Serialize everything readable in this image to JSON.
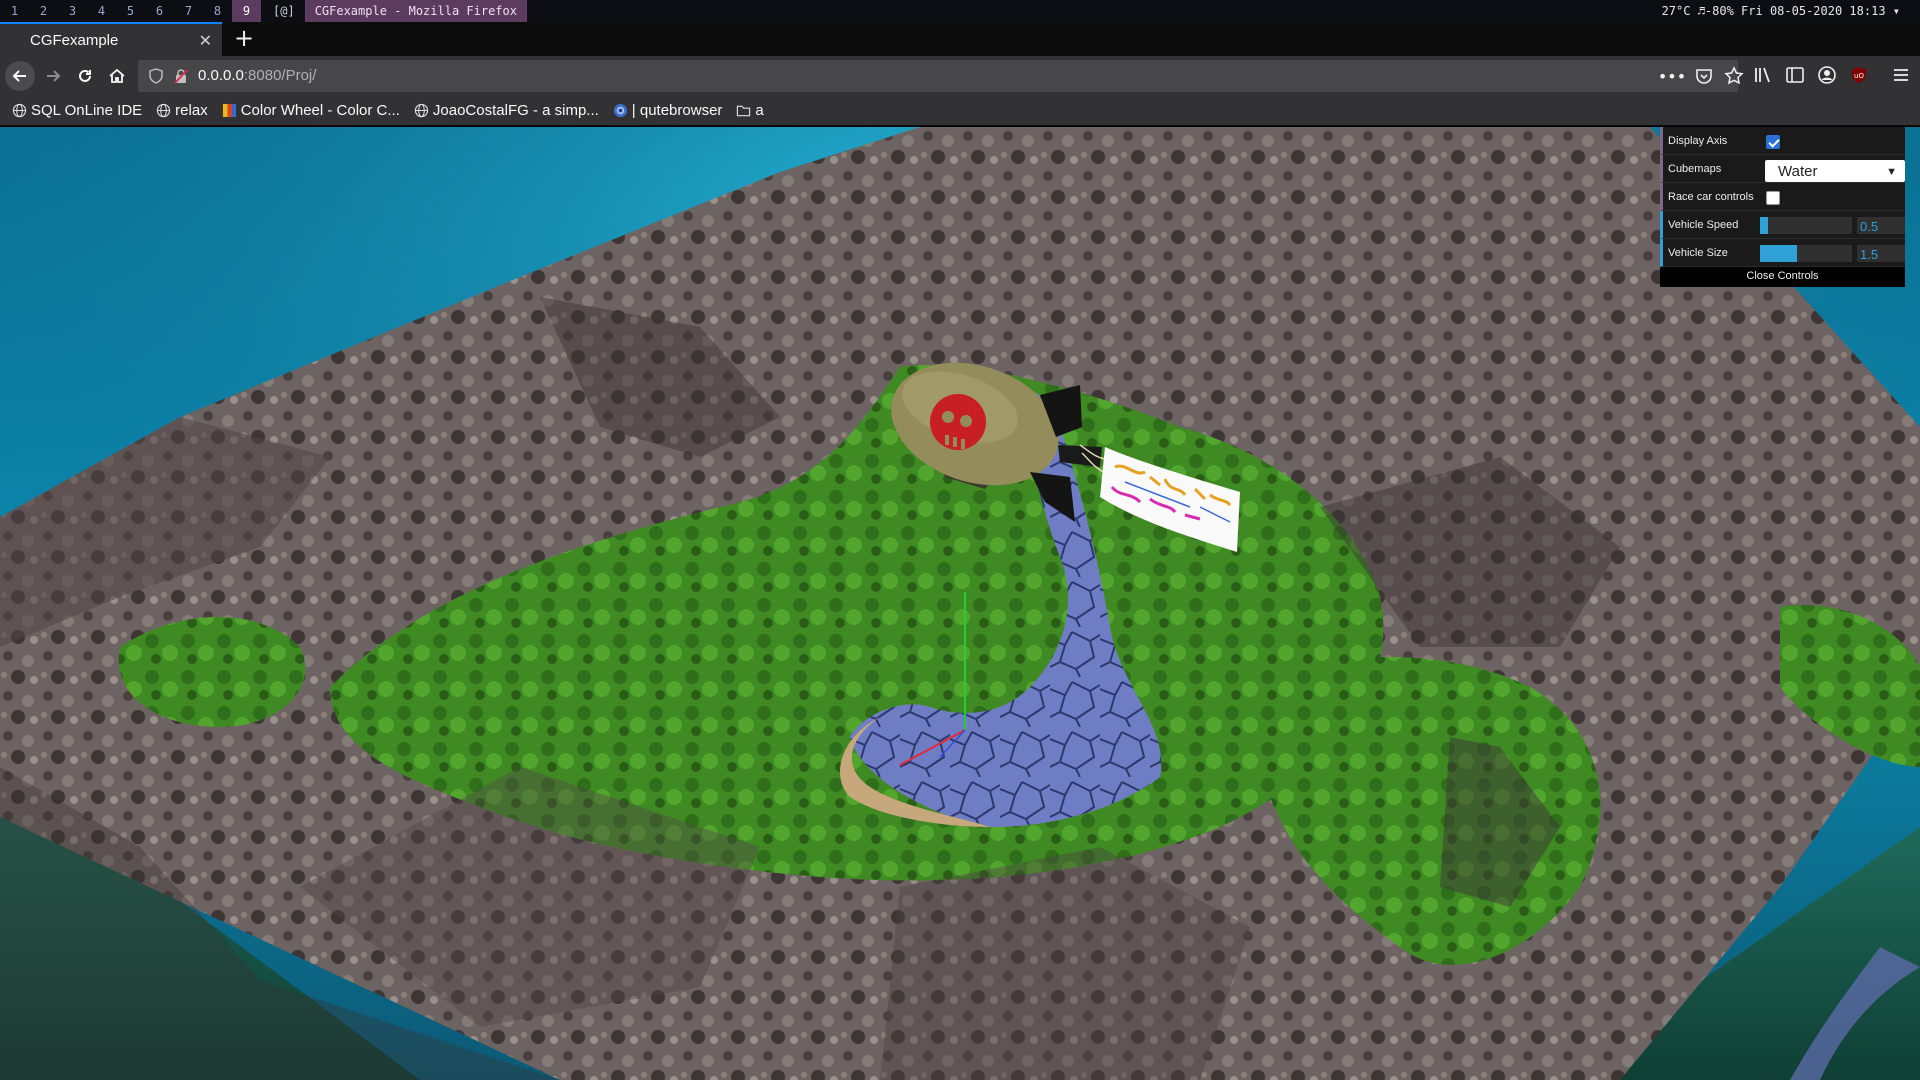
{
  "wm": {
    "workspaces": [
      "1",
      "2",
      "3",
      "4",
      "5",
      "6",
      "7",
      "8",
      "9"
    ],
    "active_workspace": "9",
    "tag": "[@]",
    "window_title": "CGFexample - Mozilla Firefox",
    "status": "27°C  ♬-80% Fri 08-05-2020 18:13 ▾"
  },
  "browser": {
    "tab_title": "CGFexample",
    "url_host": "0.0.0.0",
    "url_rest": ":8080/Proj/",
    "bookmarks": [
      {
        "label": "SQL OnLine IDE",
        "icon": "globe-icon"
      },
      {
        "label": "relax",
        "icon": "globe-icon"
      },
      {
        "label": "Color Wheel - Color C...",
        "icon": "color-wheel-icon"
      },
      {
        "label": "JoaoCostalFG - a simp...",
        "icon": "globe-icon"
      },
      {
        "label": "| qutebrowser",
        "icon": "qutebrowser-icon"
      },
      {
        "label": "a",
        "icon": "folder-icon"
      }
    ]
  },
  "gui": {
    "display_axis_label": "Display Axis",
    "display_axis": true,
    "cubemaps_label": "Cubemaps",
    "cubemaps_value": "Water",
    "race_car_label": "Race car controls",
    "race_car": false,
    "vehicle_speed_label": "Vehicle Speed",
    "vehicle_speed": "0.5",
    "vehicle_speed_fraction": 0.09,
    "vehicle_size_label": "Vehicle Size",
    "vehicle_size": "1.5",
    "vehicle_size_fraction": 0.4,
    "close_label": "Close Controls"
  },
  "colors": {
    "accent": "#0a84ff",
    "gui_number": "#2fa1d6",
    "gui_bool": "#806787",
    "wm_active": "#5b3b5e"
  }
}
